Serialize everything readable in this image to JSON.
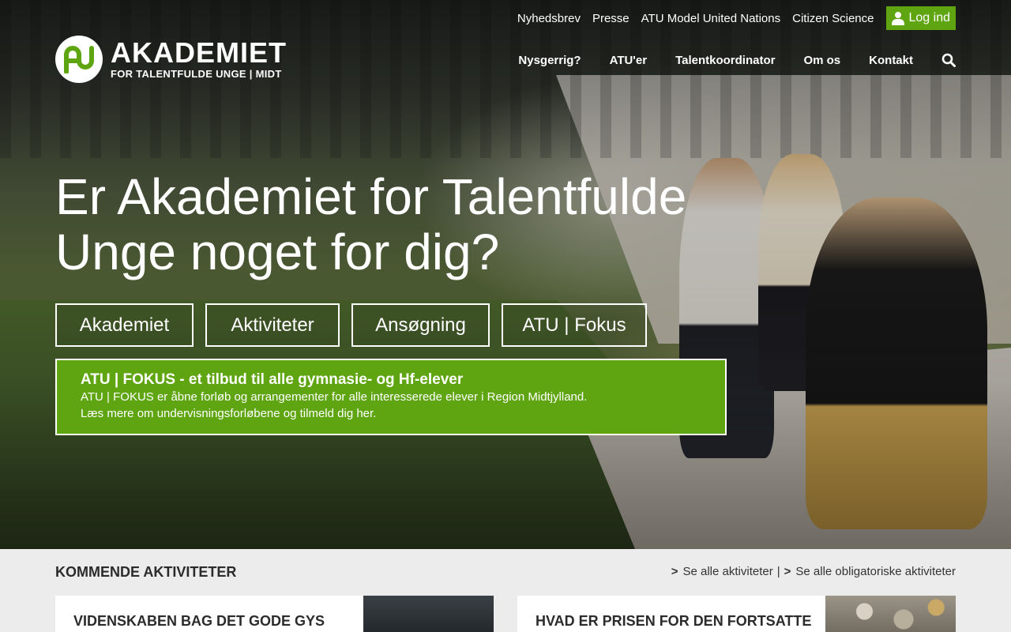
{
  "top_links": [
    "Nyhedsbrev",
    "Presse",
    "ATU Model United Nations",
    "Citizen Science"
  ],
  "login": {
    "label": "Log ind",
    "icon": "user-icon"
  },
  "logo": {
    "title": "AKADEMIET",
    "subtitle": "FOR TALENTFULDE UNGE | MIDT"
  },
  "nav": [
    "Nysgerrig?",
    "ATU'er",
    "Talentkoordinator",
    "Om os",
    "Kontakt"
  ],
  "search_icon": "search-icon",
  "hero": {
    "headline": "Er Akademiet for Talentfulde Unge noget for dig?",
    "buttons": [
      "Akademiet",
      "Aktiviteter",
      "Ansøgning",
      "ATU | Fokus"
    ]
  },
  "promo": {
    "title": "ATU | FOKUS - et tilbud til alle gymnasie- og Hf-elever",
    "line1": "ATU | FOKUS er åbne forløb og arrangementer for alle interesserede elever i Region Midtjylland.",
    "line2": "Læs mere om undervisningsforløbene og tilmeld dig her."
  },
  "activities": {
    "title": "KOMMENDE AKTIVITETER",
    "see_all": "Se alle aktiviteter",
    "see_all_mandatory": "Se alle obligatoriske aktiviteter",
    "separator": "|",
    "arrow": ">",
    "cards": [
      "VIDENSKABEN BAG DET GODE GYS",
      "HVAD ER PRISEN FOR DEN FORTSATTE"
    ]
  },
  "colors": {
    "accent": "#5fa511",
    "background": "#ececec"
  }
}
